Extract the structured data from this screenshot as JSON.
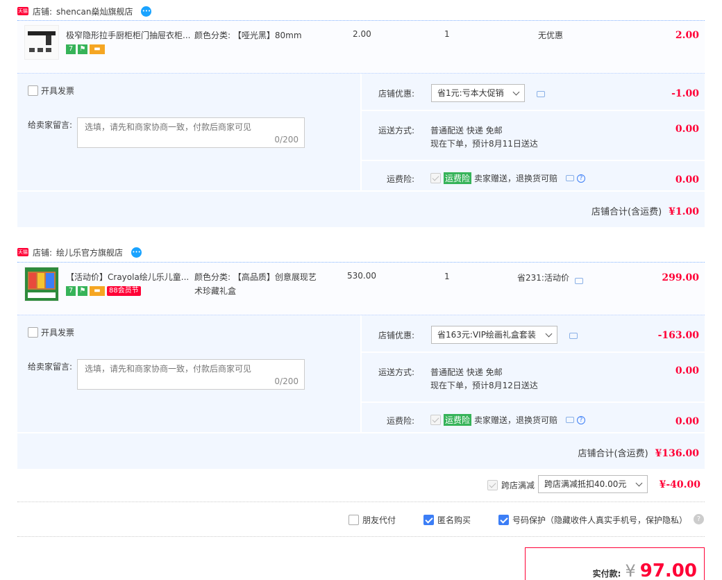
{
  "stores": [
    {
      "store_label": "店铺:",
      "store_name": "shencan燊灿旗舰店",
      "item": {
        "title": "极窄隐形拉手厨柜柜门抽屉衣柜...",
        "spec": "颜色分类: 【哑光黑】80mm",
        "unit_price": "2.00",
        "quantity": "1",
        "discount": "无优惠",
        "subtotal": "2.00"
      },
      "invoice": "开具发票",
      "message_label": "给卖家留言:",
      "message_placeholder": "选填，请先和商家协商一致，付款后商家可见",
      "message_count": "0/200",
      "promo_label": "店铺优惠:",
      "promo_value": "省1元:亏本大促销",
      "promo_amount": "-1.00",
      "shipping_label": "运送方式:",
      "shipping_method": "普通配送 快递 免邮",
      "shipping_eta": "现在下单，预计8月11日送达",
      "shipping_amount": "0.00",
      "insurance_label": "运费险:",
      "insurance_tag": "运费险",
      "insurance_text": "卖家赠送，退换货可赔",
      "insurance_amount": "0.00",
      "total_label": "店铺合计(含运费)",
      "total_amount": "¥1.00"
    },
    {
      "store_label": "店铺:",
      "store_name": "绘儿乐官方旗舰店",
      "item": {
        "title": "【活动价】Crayola绘儿乐儿童...",
        "spec_line1": "颜色分类: 【高品质】创意展现艺",
        "spec_line2": "术珍藏礼盒",
        "unit_price": "530.00",
        "quantity": "1",
        "discount": "省231:活动价",
        "subtotal": "299.00",
        "badge_88": "88会员节"
      },
      "invoice": "开具发票",
      "message_label": "给卖家留言:",
      "message_placeholder": "选填，请先和商家协商一致，付款后商家可见",
      "message_count": "0/200",
      "promo_label": "店铺优惠:",
      "promo_value": "省163元:VIP绘画礼盒套装",
      "promo_amount": "-163.00",
      "shipping_label": "运送方式:",
      "shipping_method": "普通配送 快递 免邮",
      "shipping_eta": "现在下单，预计8月12日送达",
      "shipping_amount": "0.00",
      "insurance_label": "运费险:",
      "insurance_tag": "运费险",
      "insurance_text": "卖家赠送，退换货可赔",
      "insurance_amount": "0.00",
      "total_label": "店铺合计(含运费)",
      "total_amount": "¥136.00"
    }
  ],
  "cross_store": {
    "label": "跨店满减",
    "select_value": "跨店满减抵扣40.00元",
    "amount": "¥-40.00"
  },
  "options": {
    "friend_pay": "朋友代付",
    "anonymous": "匿名购买",
    "number_protect": "号码保护（隐藏收件人真实手机号，保护隐私）"
  },
  "payment": {
    "label": "实付款:",
    "currency": "¥",
    "amount": "97.00"
  },
  "colors": {
    "accent": "#ff0036",
    "blue": "#3c7ef6",
    "panel": "#f2f7ff"
  }
}
